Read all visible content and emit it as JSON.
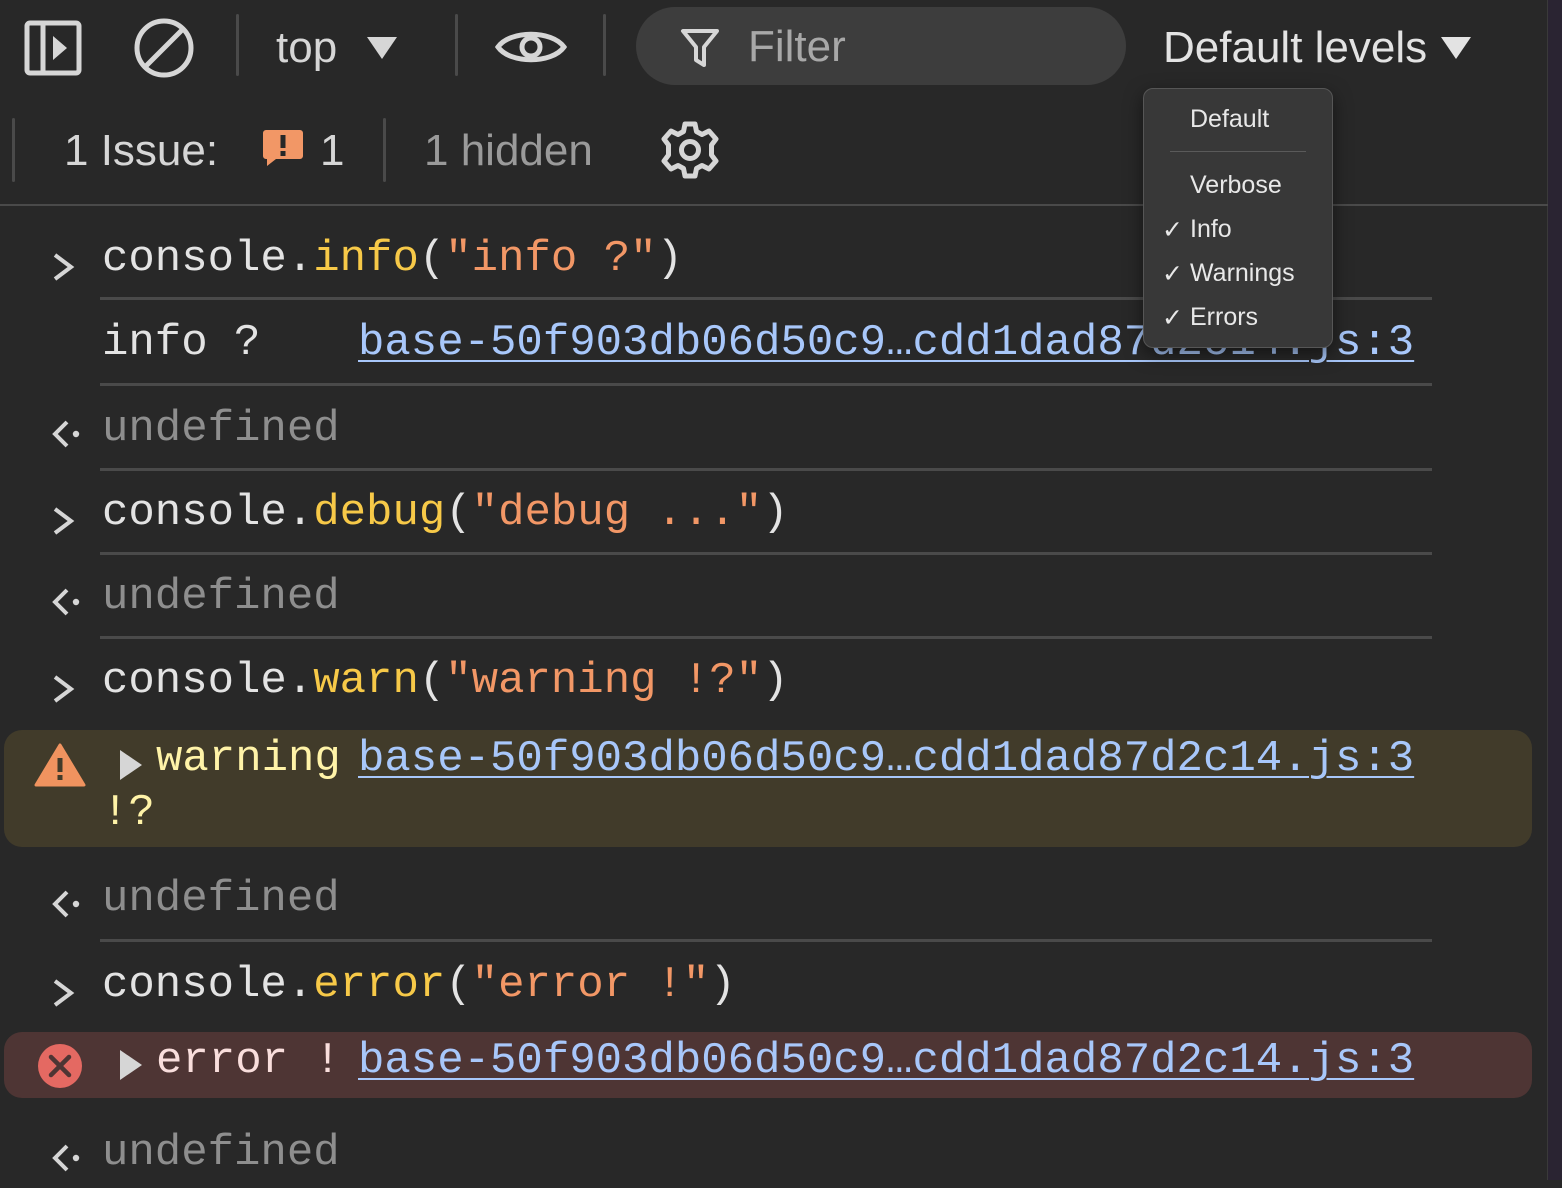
{
  "toolbar": {
    "sidebar_toggle_icon": "sidebar-panel-icon",
    "clear_icon": "clear-console-icon",
    "context_label": "top",
    "live_expression_icon": "eye-icon",
    "filter_placeholder": "Filter",
    "levels_label": "Default levels"
  },
  "issues": {
    "label": "1 Issue:",
    "count": "1",
    "hidden": "1 hidden",
    "settings_icon": "gear-icon"
  },
  "console": {
    "entries": [
      {
        "kind": "input",
        "obj": "console.",
        "method": "info",
        "open": "(",
        "arg": "\"info ?\"",
        "close": ")"
      },
      {
        "kind": "log",
        "message": "info ?",
        "source": "base-50f903db06d50c9…cdd1dad87d2c14.js:3"
      },
      {
        "kind": "result",
        "value": "undefined"
      },
      {
        "kind": "input",
        "obj": "console.",
        "method": "debug",
        "open": "(",
        "arg": "\"debug ...\"",
        "close": ")"
      },
      {
        "kind": "result",
        "value": "undefined"
      },
      {
        "kind": "input",
        "obj": "console.",
        "method": "warn",
        "open": "(",
        "arg": "\"warning !?\"",
        "close": ")"
      },
      {
        "kind": "warning",
        "message": "warning",
        "message_cont": "!?",
        "source": "base-50f903db06d50c9…cdd1dad87d2c14.js:3"
      },
      {
        "kind": "result",
        "value": "undefined"
      },
      {
        "kind": "input",
        "obj": "console.",
        "method": "error",
        "open": "(",
        "arg": "\"error !\"",
        "close": ")"
      },
      {
        "kind": "error",
        "message": "error !",
        "source": "base-50f903db06d50c9…cdd1dad87d2c14.js:3"
      },
      {
        "kind": "result",
        "value": "undefined"
      }
    ]
  },
  "levels_menu": {
    "default": "Default",
    "items": [
      {
        "label": "Verbose",
        "checked": ""
      },
      {
        "label": "Info",
        "checked": "✓"
      },
      {
        "label": "Warnings",
        "checked": "✓"
      },
      {
        "label": "Errors",
        "checked": "✓"
      }
    ]
  },
  "colors": {
    "background": "#282828",
    "warning_bg": "#413b2a",
    "error_bg": "#4e3534",
    "function": "#f7c948",
    "string": "#f29766",
    "link": "#a8c7fa",
    "issue_badge": "#f29766",
    "error_icon": "#e46962",
    "warning_icon": "#f0935f"
  }
}
